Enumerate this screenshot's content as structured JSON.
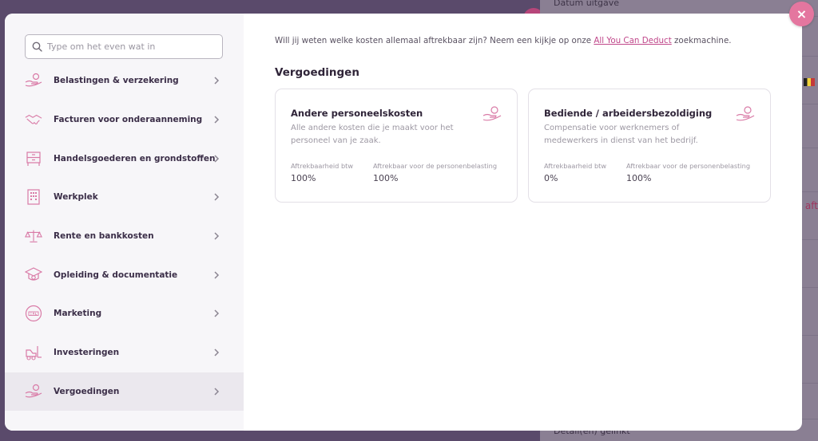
{
  "background": {
    "label_top": "Datum uitgave",
    "label_bottom": "Detail(en) gelinkt",
    "accent_text": "t aft"
  },
  "search": {
    "placeholder": "Type om het even wat in"
  },
  "categories": [
    {
      "label": "Belastingen & verzekering",
      "icon": "hand-coin-icon"
    },
    {
      "label": "Facturen voor onderaanneming",
      "icon": "handshake-icon"
    },
    {
      "label": "Handelsgoederen en grondstoffen",
      "icon": "cabinet-icon"
    },
    {
      "label": "Werkplek",
      "icon": "building-icon"
    },
    {
      "label": "Rente en bankkosten",
      "icon": "scales-icon"
    },
    {
      "label": "Opleiding & documentatie",
      "icon": "graduation-icon"
    },
    {
      "label": "Marketing",
      "icon": "sale-badge-icon"
    },
    {
      "label": "Investeringen",
      "icon": "forklift-icon"
    },
    {
      "label": "Vergoedingen",
      "icon": "hand-coin-icon",
      "active": true
    }
  ],
  "main": {
    "intro_before": "Will jij weten welke kosten allemaal aftrekbaar zijn? Neem een kijkje op onze ",
    "intro_link": "All You Can Deduct",
    "intro_after": " zoekmachine.",
    "section_title": "Vergoedingen",
    "cards": [
      {
        "title": "Andere personeelskosten",
        "description": "Alle andere kosten die je maakt voor het personeel van je zaak.",
        "stat1_label": "Aftrekbaarheid btw",
        "stat1_value": "100%",
        "stat2_label": "Aftrekbaar voor de personenbelasting",
        "stat2_value": "100%"
      },
      {
        "title": "Bediende / arbeidersbezoldiging",
        "description": "Compensatie voor werknemers of medewerkers in dienst van het bedrijf.",
        "stat1_label": "Aftrekbaarheid btw",
        "stat1_value": "0%",
        "stat2_label": "Aftrekbaar voor de personenbelasting",
        "stat2_value": "100%"
      }
    ]
  },
  "close_label": "×",
  "colors": {
    "accent": "#c0478a",
    "close_button": "#e4769f",
    "icon_stroke": "#d97aa6"
  }
}
